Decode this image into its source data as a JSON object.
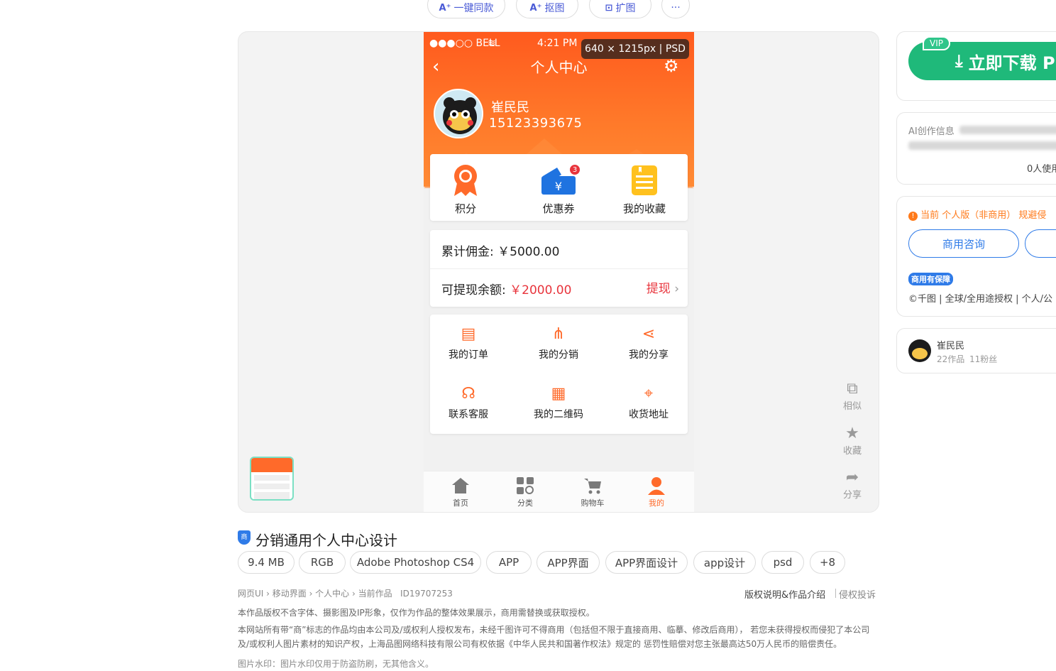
{
  "tools": {
    "one_click": "一键同款",
    "cutout": "抠图",
    "expand": "扩图",
    "more": "···"
  },
  "phone": {
    "status_carrier": "●●●○○ BELL",
    "status_time": "4:21 PM",
    "size_badge": "640 × 1215px | PSD",
    "nav_title": "个人中心",
    "user_name": "崔民民",
    "user_phone": "15123393675",
    "quick": [
      {
        "label": "积分",
        "icon": "medal-icon"
      },
      {
        "label": "优惠券",
        "icon": "coupon-icon",
        "badge": "3"
      },
      {
        "label": "我的收藏",
        "icon": "favorites-icon"
      }
    ],
    "total_commission_label": "累计佣金:",
    "total_commission_value": "￥5000.00",
    "withdrawable_label": "可提现余额:",
    "withdrawable_value": "￥2000.00",
    "withdraw_label": "提现",
    "menu": [
      {
        "label": "我的订单",
        "icon": "order-icon"
      },
      {
        "label": "我的分销",
        "icon": "distribution-icon"
      },
      {
        "label": "我的分享",
        "icon": "share-icon"
      },
      {
        "label": "联系客服",
        "icon": "customer-service-icon"
      },
      {
        "label": "我的二维码",
        "icon": "qrcode-icon"
      },
      {
        "label": "收货地址",
        "icon": "location-icon"
      }
    ],
    "tabs": [
      {
        "label": "首页",
        "icon": "home-icon"
      },
      {
        "label": "分类",
        "icon": "category-icon"
      },
      {
        "label": "购物车",
        "icon": "cart-icon"
      },
      {
        "label": "我的",
        "icon": "user-icon",
        "active": true
      }
    ],
    "accent": "#ff6a2a"
  },
  "preview_side": {
    "similar": "相似",
    "collect": "收藏",
    "share": "分享"
  },
  "right": {
    "vip": "VIP",
    "download": "立即下载 P",
    "ai_info": "AI创作信息",
    "usage": "0人使用",
    "license_note": "当前 个人版（非商用） 规避侵",
    "commercial_btn": "商用咨询",
    "guarantee": "商用有保障",
    "license_text": "©千图 | 全球/全用途授权 | 个人/公",
    "author_name": "崔民民",
    "author_works": "22作品",
    "author_fans": "11粉丝"
  },
  "info": {
    "title": "分销通用个人中心设计",
    "shield": "商",
    "tags": [
      "9.4 MB",
      "RGB",
      "Adobe Photoshop CS4",
      "APP",
      "APP界面",
      "APP界面设计",
      "app设计",
      "psd",
      "+8"
    ],
    "breadcrumb": "网页UI › 移动界面 › 个人中心 › 当前作品   ID19707253",
    "copyright_link": "版权说明&作品介绍",
    "report_link": "侵权投诉",
    "notice1": "本作品版权不含字体、摄影图及IP形象，仅作为作品的整体效果展示，商用需替换或获取授权。",
    "notice2": "本网站所有带“商”标志的作品均由本公司及/或权利人授权发布，未经千图许可不得商用（包括但不限于直接商用、临摹、修改后商用）， 若您未获得授权而侵犯了本公司及/或权利人图片素材的知识产权，上海品图网络科技有限公司有权依据《中华人民共和国著作权法》规定的 惩罚性赔偿对您主张最高达50万人民币的赔偿责任。",
    "notice3": "图片水印：图片水印仅用于防盗防刷，无其他含义。"
  }
}
